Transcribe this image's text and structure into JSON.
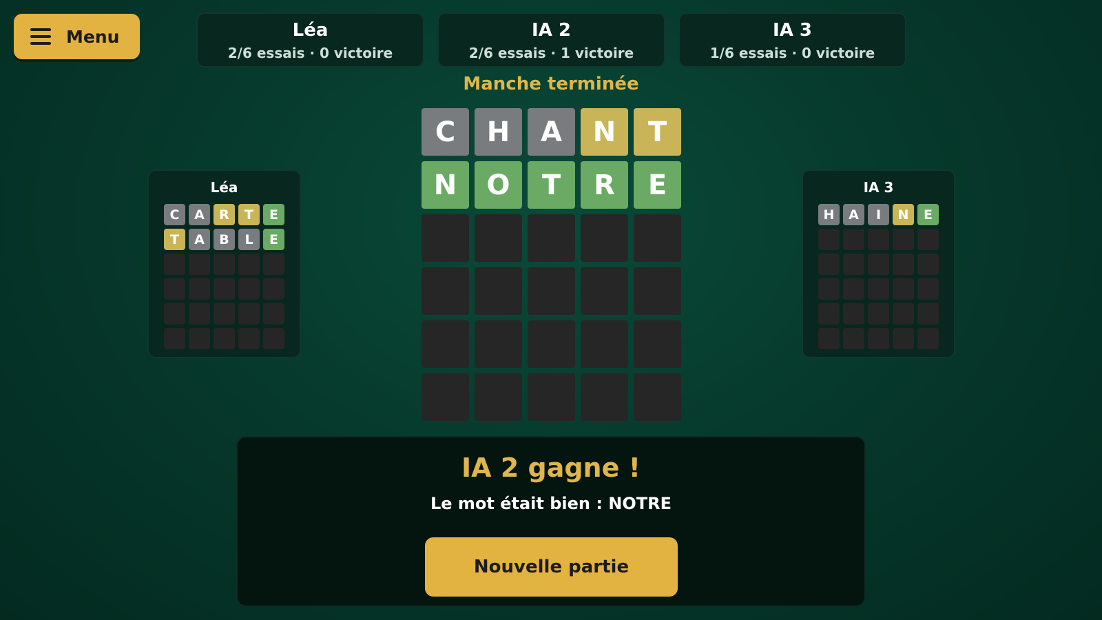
{
  "menu": {
    "label": "Menu",
    "icon": "hamburger-menu-icon"
  },
  "scoreboard": [
    {
      "name": "Léa",
      "stats": "2/6 essais · 0 victoire"
    },
    {
      "name": "IA 2",
      "stats": "2/6 essais · 1 victoire"
    },
    {
      "name": "IA 3",
      "stats": "1/6 essais · 0 victoire"
    }
  ],
  "status": "Manche terminée",
  "colors": {
    "correct": "#6aaa64",
    "present": "#c9b458",
    "absent": "#787c7e",
    "empty": "#262626",
    "accent": "#e3b341"
  },
  "main_board": {
    "rows": [
      [
        {
          "l": "C",
          "s": "x"
        },
        {
          "l": "H",
          "s": "x"
        },
        {
          "l": "A",
          "s": "x"
        },
        {
          "l": "N",
          "s": "y"
        },
        {
          "l": "T",
          "s": "y"
        }
      ],
      [
        {
          "l": "N",
          "s": "g"
        },
        {
          "l": "O",
          "s": "g"
        },
        {
          "l": "T",
          "s": "g"
        },
        {
          "l": "R",
          "s": "g"
        },
        {
          "l": "E",
          "s": "g"
        }
      ]
    ],
    "total_rows": 6
  },
  "side_left": {
    "name": "Léa",
    "rows": [
      [
        {
          "l": "C",
          "s": "x"
        },
        {
          "l": "A",
          "s": "x"
        },
        {
          "l": "R",
          "s": "y"
        },
        {
          "l": "T",
          "s": "y"
        },
        {
          "l": "E",
          "s": "g"
        }
      ],
      [
        {
          "l": "T",
          "s": "y"
        },
        {
          "l": "A",
          "s": "x"
        },
        {
          "l": "B",
          "s": "x"
        },
        {
          "l": "L",
          "s": "x"
        },
        {
          "l": "E",
          "s": "g"
        }
      ]
    ],
    "total_rows": 6
  },
  "side_right": {
    "name": "IA 3",
    "rows": [
      [
        {
          "l": "H",
          "s": "x"
        },
        {
          "l": "A",
          "s": "x"
        },
        {
          "l": "I",
          "s": "x"
        },
        {
          "l": "N",
          "s": "y"
        },
        {
          "l": "E",
          "s": "g"
        }
      ]
    ],
    "total_rows": 6
  },
  "result": {
    "title": "IA 2 gagne !",
    "message": "Le mot était bien : NOTRE",
    "button": "Nouvelle partie"
  }
}
